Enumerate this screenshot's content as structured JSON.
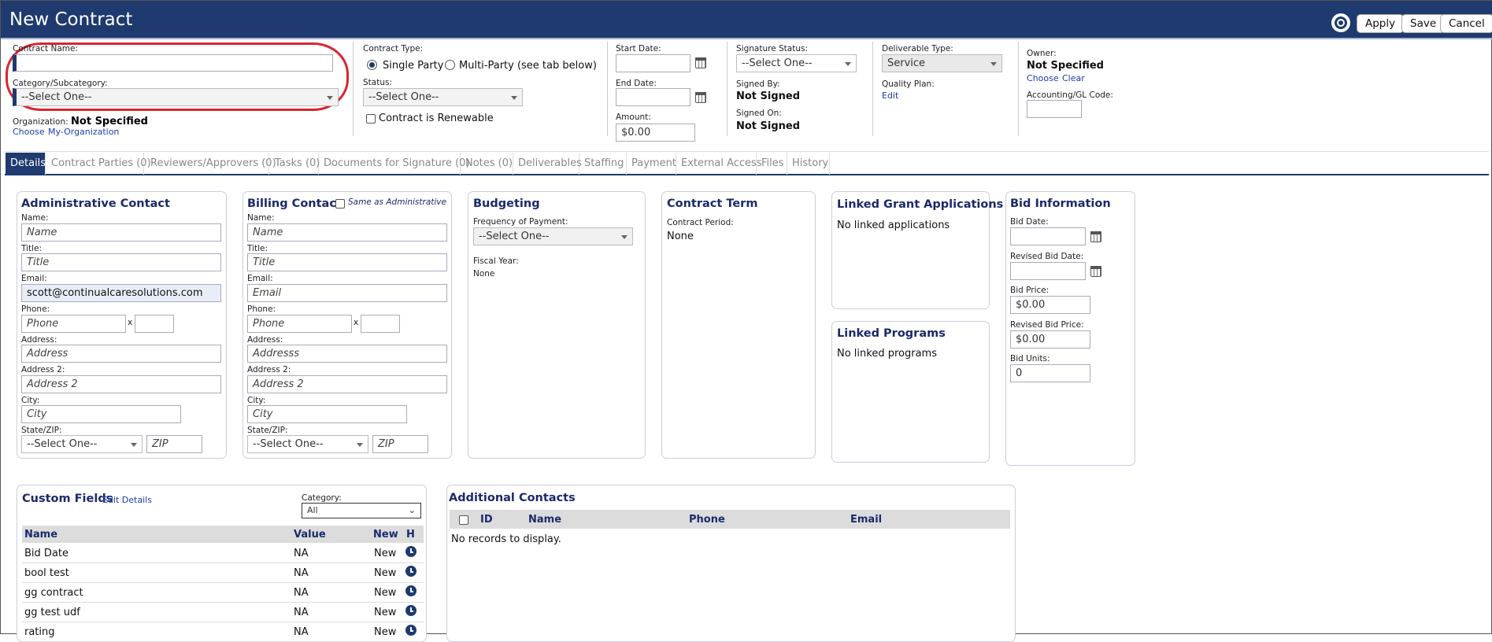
{
  "header": {
    "title": "New Contract",
    "buttons": {
      "apply": "Apply",
      "save": "Save",
      "cancel": "Cancel"
    }
  },
  "form": {
    "contract_name_label": "Contract Name:",
    "category_label": "Category/Subcategory:",
    "category_value": "--Select One--",
    "organization_label": "Organization:",
    "organization_value": "Not Specified",
    "organization_links": {
      "choose": "Choose",
      "my_org": "My-Organization"
    },
    "contract_type_label": "Contract Type:",
    "contract_type_options": [
      "Single Party",
      "Multi-Party (see tab below)"
    ],
    "status_label": "Status:",
    "status_value": "--Select One--",
    "renewable_label": "Contract is Renewable",
    "start_date_label": "Start Date:",
    "end_date_label": "End Date:",
    "amount_label": "Amount:",
    "amount_value": "$0.00",
    "signature_status_label": "Signature Status:",
    "signature_status_value": "--Select One--",
    "signed_by_label": "Signed By:",
    "signed_by_value": "Not Signed",
    "signed_on_label": "Signed On:",
    "signed_on_value": "Not Signed",
    "deliverable_type_label": "Deliverable Type:",
    "deliverable_type_value": "Service",
    "quality_plan_label": "Quality Plan:",
    "quality_plan_link": "Edit",
    "owner_label": "Owner:",
    "owner_value": "Not Specified",
    "owner_links": {
      "choose": "Choose",
      "clear": "Clear"
    },
    "gl_code_label": "Accounting/GL Code:"
  },
  "tabs": [
    "Details",
    "Contract Parties (0)",
    "Reviewers/Approvers (0)",
    "Tasks (0)",
    "Documents for Signature (0)",
    "Notes (0)",
    "Deliverables",
    "Staffing",
    "Payment",
    "External Access",
    "Files",
    "History"
  ],
  "admin_contact": {
    "title": "Administrative Contact",
    "labels": {
      "name": "Name:",
      "title": "Title:",
      "email": "Email:",
      "phone": "Phone:",
      "address": "Address:",
      "address2": "Address 2:",
      "city": "City:",
      "state_zip": "State/ZIP:"
    },
    "placeholders": {
      "name": "Name",
      "title": "Title",
      "phone": "Phone",
      "address": "Address",
      "address2": "Address 2",
      "city": "City",
      "zip": "ZIP"
    },
    "email_value": "scott@continualcaresolutions.com",
    "state_value": "--Select One--",
    "ext_label": "x"
  },
  "billing_contact": {
    "title": "Billing Contact",
    "same_as_label": "Same as Administrative",
    "labels": {
      "name": "Name:",
      "title": "Title:",
      "email": "Email:",
      "phone": "Phone:",
      "address": "Address:",
      "address2": "Address 2:",
      "city": "City:",
      "state_zip": "State/ZIP:"
    },
    "placeholders": {
      "name": "Name",
      "title": "Title",
      "email": "Email",
      "phone": "Phone",
      "address": "Addresss",
      "address2": "Address 2",
      "city": "City",
      "zip": "ZIP"
    },
    "state_value": "--Select One--",
    "ext_label": "x"
  },
  "budgeting": {
    "title": "Budgeting",
    "frequency_label": "Frequency of Payment:",
    "frequency_value": "--Select One--",
    "fiscal_year_label": "Fiscal Year:",
    "fiscal_year_value": "None"
  },
  "contract_term": {
    "title": "Contract Term",
    "period_label": "Contract Period:",
    "period_value": "None"
  },
  "linked_grants": {
    "title": "Linked Grant Applications",
    "empty": "No linked applications"
  },
  "linked_programs": {
    "title": "Linked Programs",
    "empty": "No linked programs"
  },
  "bid_info": {
    "title": "Bid Information",
    "bid_date_label": "Bid Date:",
    "revised_bid_date_label": "Revised Bid Date:",
    "bid_price_label": "Bid Price:",
    "bid_price_value": "$0.00",
    "revised_bid_price_label": "Revised Bid Price:",
    "revised_bid_price_value": "$0.00",
    "bid_units_label": "Bid Units:",
    "bid_units_value": "0"
  },
  "custom_fields": {
    "title": "Custom Fields",
    "edit_link": "Edit Details",
    "category_label": "Category:",
    "category_value": "All",
    "columns": [
      "Name",
      "Value",
      "New",
      "H"
    ],
    "rows": [
      {
        "name": "Bid Date",
        "value": "NA",
        "new": "New"
      },
      {
        "name": "bool test",
        "value": "NA",
        "new": "New"
      },
      {
        "name": "gg contract",
        "value": "NA",
        "new": "New"
      },
      {
        "name": "gg test udf",
        "value": "NA",
        "new": "New"
      },
      {
        "name": "rating",
        "value": "NA",
        "new": "New"
      }
    ]
  },
  "additional_contacts": {
    "title": "Additional Contacts",
    "columns": [
      "ID",
      "Name",
      "Phone",
      "Email"
    ],
    "empty": "No records to display."
  },
  "colors": {
    "header_bg": "#1e3a6e",
    "title_text": "#1b2a6b",
    "highlight_ring": "#d9262c",
    "link": "#1a3ea8"
  }
}
